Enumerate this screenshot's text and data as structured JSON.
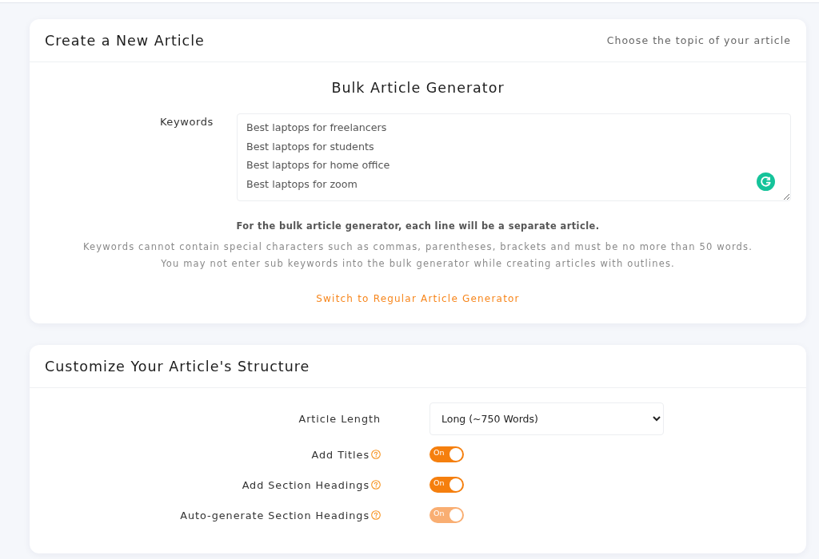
{
  "top_card": {
    "title": "Create a New Article",
    "subtitle": "Choose the topic of your article",
    "generator_title": "Bulk Article Generator",
    "keywords": {
      "label": "Keywords",
      "lines": [
        "Best laptops for freelancers",
        "Best laptops for students",
        "Best laptops for home office",
        "Best laptops for zoom"
      ]
    },
    "note": "For the bulk article generator, each line will be a separate article.",
    "rules": [
      "Keywords cannot contain special characters such as commas, parentheses, brackets and must be no more than 50 words.",
      "You may not enter sub keywords into the bulk generator while creating articles with outlines."
    ],
    "switch_link": "Switch to Regular Article Generator"
  },
  "structure_card": {
    "title": "Customize Your Article's Structure",
    "settings": [
      {
        "kind": "select",
        "label": "Article Length",
        "help": false,
        "value": "Long (~750 Words)"
      },
      {
        "kind": "toggle",
        "label": "Add Titles",
        "help": true,
        "on": true,
        "disabled": false,
        "state_label": "On"
      },
      {
        "kind": "toggle",
        "label": "Add Section Headings",
        "help": true,
        "on": true,
        "disabled": false,
        "state_label": "On"
      },
      {
        "kind": "toggle",
        "label": "Auto-generate Section Headings",
        "help": true,
        "on": true,
        "disabled": true,
        "state_label": "On"
      }
    ]
  }
}
